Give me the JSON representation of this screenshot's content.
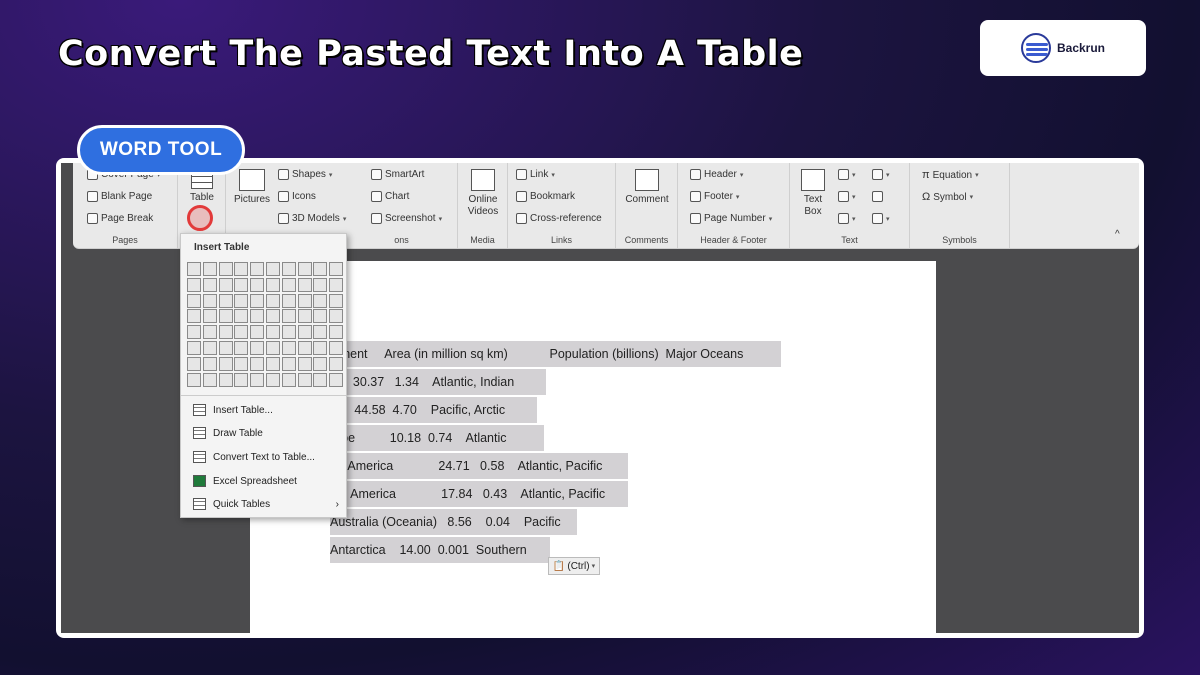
{
  "header": {
    "title": "Convert The Pasted Text Into A Table"
  },
  "logo": {
    "text": "Backrun"
  },
  "badge": {
    "label": "WORD TOOL"
  },
  "ribbon": {
    "pages": {
      "label": "Pages",
      "items": [
        "Cover Page",
        "Blank Page",
        "Page Break"
      ]
    },
    "tables": {
      "label": "Table"
    },
    "illustrations": {
      "pictures": "Pictures",
      "shapes": "Shapes",
      "icons": "Icons",
      "models": "3D Models",
      "smartart": "SmartArt",
      "chart": "Chart",
      "screenshot": "Screenshot",
      "label": "ons"
    },
    "media": {
      "item": "Online Videos",
      "label": "Media"
    },
    "links": {
      "items": [
        "Link",
        "Bookmark",
        "Cross-reference"
      ],
      "label": "Links"
    },
    "comments": {
      "item": "Comment",
      "label": "Comments"
    },
    "header_footer": {
      "items": [
        "Header",
        "Footer",
        "Page Number"
      ],
      "label": "Header & Footer"
    },
    "text": {
      "item": "Text Box",
      "label": "Text"
    },
    "symbols": {
      "items": [
        "Equation",
        "Symbol"
      ],
      "label": "Symbols"
    }
  },
  "insert_table_menu": {
    "title": "Insert Table",
    "items": [
      {
        "label": "Insert Table...",
        "icon": "table-icon"
      },
      {
        "label": "Draw Table",
        "icon": "pencil-table-icon"
      },
      {
        "label": "Convert Text to Table...",
        "icon": "convert-icon"
      },
      {
        "label": "Excel Spreadsheet",
        "icon": "excel-icon"
      },
      {
        "label": "Quick Tables",
        "icon": "quick-table-icon"
      }
    ]
  },
  "document": {
    "rows": [
      "ntinent     Area (in million sq km)            Population (billions)  Major Oceans",
      "ica  30.37   1.34    Atlantic, Indian",
      "a     44.58  4.70    Pacific, Arctic",
      "rope          10.18  0.74    Atlantic",
      "rth America             24.71   0.58    Atlantic, Pacific",
      "uth America             17.84   0.43    Atlantic, Pacific",
      "Australia (Oceania)   8.56    0.04    Pacific",
      "Antarctica    14.00  0.001  Southern"
    ],
    "paste_options": "(Ctrl)"
  }
}
